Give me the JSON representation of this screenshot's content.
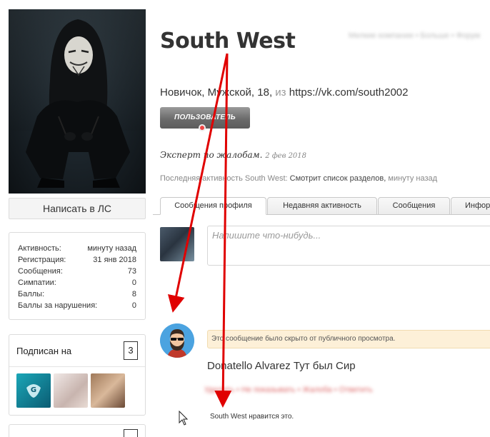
{
  "profile": {
    "username": "South West",
    "breadcrumbs_blurred": "Мелкие компании • Больше • Форум",
    "info": {
      "rank": "Новичок",
      "gender": "Мужской",
      "age": "18",
      "from_word": "из",
      "location": "https://vk.com/south2002"
    },
    "badge": "ПОЛЬЗОВАТЕЛЬ",
    "custom_title": "Эксперт по жалобам.",
    "custom_title_date": "2 фев 2018",
    "last_activity_label": "Последняя активность South West:",
    "last_activity_action": "Смотрит список разделов,",
    "last_activity_time": "минуту назад"
  },
  "sidebar": {
    "pm_button": "Написать в ЛС",
    "stats": [
      {
        "label": "Активность:",
        "value": "минуту назад"
      },
      {
        "label": "Регистрация:",
        "value": "31 янв 2018"
      },
      {
        "label": "Сообщения:",
        "value": "73"
      },
      {
        "label": "Симпатии:",
        "value": "0"
      },
      {
        "label": "Баллы:",
        "value": "8"
      },
      {
        "label": "Баллы за нарушения:",
        "value": "0"
      }
    ],
    "following_title": "Подписан на",
    "following_count": "3"
  },
  "tabs": [
    {
      "label": "Сообщения профиля",
      "active": true
    },
    {
      "label": "Недавняя активность",
      "active": false
    },
    {
      "label": "Сообщения",
      "active": false
    },
    {
      "label": "Инфор",
      "active": false
    }
  ],
  "status_input": {
    "placeholder": "Напишите что-нибудь..."
  },
  "message": {
    "hidden_notice": "Это сообщение было скрыто от публичного просмотра.",
    "text": "Donatello Alvarez Тут был Сир",
    "actions_blurred": "Удалить • Не показывать • Жалоба • Ответить",
    "likes": "South West нравится это."
  },
  "colors": {
    "arrow": "#e00000",
    "notice_bg": "#fdf0d8",
    "badge": "#6b6b6b"
  }
}
